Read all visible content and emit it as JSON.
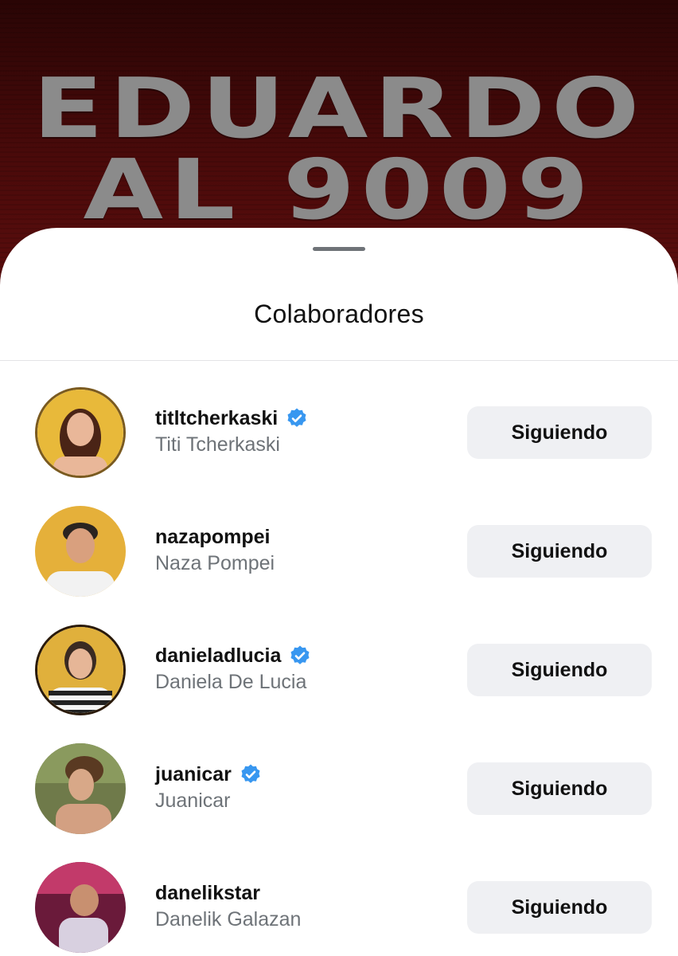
{
  "background": {
    "title_line_1": "EDUARDO",
    "title_line_2": "AL 9009"
  },
  "sheet": {
    "title": "Colaboradores"
  },
  "collaborators": [
    {
      "username": "titltcherkaski",
      "full_name": "Titi Tcherkaski",
      "verified": true,
      "button_label": "Siguiendo"
    },
    {
      "username": "nazapompei",
      "full_name": "Naza Pompei",
      "verified": false,
      "button_label": "Siguiendo"
    },
    {
      "username": "danieladlucia",
      "full_name": "Daniela De Lucia",
      "verified": true,
      "button_label": "Siguiendo"
    },
    {
      "username": "juanicar",
      "full_name": "Juanicar",
      "verified": true,
      "button_label": "Siguiendo"
    },
    {
      "username": "danelikstar",
      "full_name": "Danelik Galazan",
      "verified": false,
      "button_label": "Siguiendo"
    }
  ],
  "colors": {
    "verified_badge": "#3897f0",
    "button_bg": "#eff0f3",
    "backdrop_red": "#4a0a0a"
  },
  "icons": {
    "verified": "verified-badge-icon"
  }
}
